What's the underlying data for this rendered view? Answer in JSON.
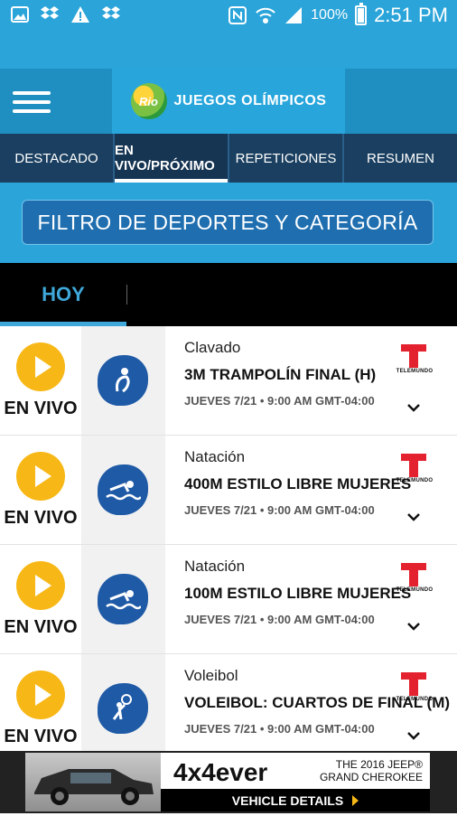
{
  "status_bar": {
    "battery": "100%",
    "time": "2:51 PM"
  },
  "app": {
    "title": "JUEGOS OLÍMPICOS",
    "logo_text": "Rio"
  },
  "tabs": [
    {
      "label": "DESTACADO"
    },
    {
      "label": "EN VIVO/PRÓXIMO"
    },
    {
      "label": "REPETICIONES"
    },
    {
      "label": "RESUMEN"
    }
  ],
  "filter": {
    "label": "FILTRO DE DEPORTES Y CATEGORÍA"
  },
  "day": {
    "label": "HOY"
  },
  "events": [
    {
      "live_label": "EN VIVO",
      "sport": "Clavado",
      "title": "3M TRAMPOLÍN FINAL (H)",
      "time": "JUEVES 7/21 • 9:00 AM GMT-04:00",
      "network": "TELEMUNDO",
      "icon": "diving-icon"
    },
    {
      "live_label": "EN VIVO",
      "sport": "Natación",
      "title": "400M ESTILO LIBRE MUJERES",
      "time": "JUEVES 7/21 • 9:00 AM GMT-04:00",
      "network": "TELEMUNDO",
      "icon": "swimming-icon"
    },
    {
      "live_label": "EN VIVO",
      "sport": "Natación",
      "title": "100M ESTILO LIBRE MUJERES",
      "time": "JUEVES 7/21 • 9:00 AM GMT-04:00",
      "network": "TELEMUNDO",
      "icon": "swimming-icon"
    },
    {
      "live_label": "EN VIVO",
      "sport": "Voleibol",
      "title": "VOLEIBOL: CUARTOS DE FINAL (M)",
      "time": "JUEVES 7/21 • 9:00 AM GMT-04:00",
      "network": "TELEMUNDO",
      "icon": "volleyball-icon"
    }
  ],
  "ad": {
    "headline": "4x4ever",
    "line1": "THE 2016 JEEP®",
    "line2": "GRAND CHEROKEE",
    "cta": "VEHICLE DETAILS"
  },
  "colors": {
    "primary": "#2aa4d9",
    "navy": "#1a3f60",
    "accent": "#f7b817",
    "telemundo": "#e4212f"
  }
}
